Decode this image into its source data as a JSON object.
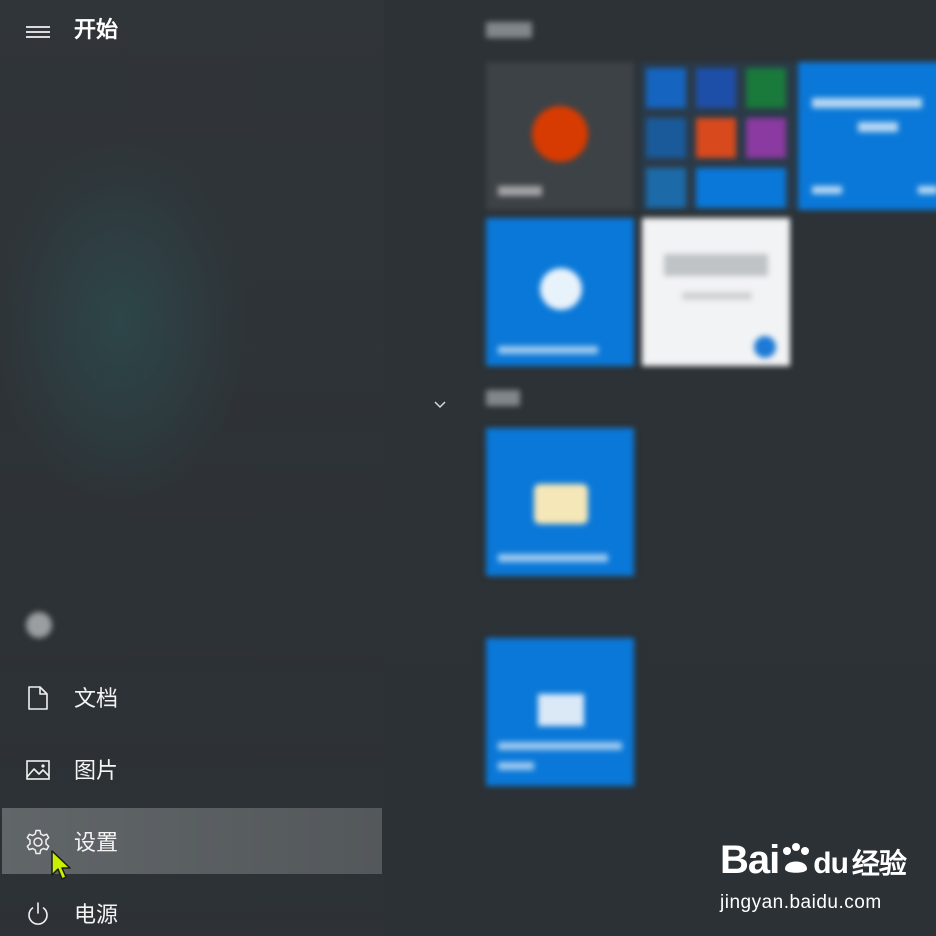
{
  "start_menu": {
    "title": "开始",
    "user_name": "",
    "items": [
      {
        "label": "文档",
        "icon": "document-icon"
      },
      {
        "label": "图片",
        "icon": "pictures-icon"
      },
      {
        "label": "设置",
        "icon": "gear-icon",
        "selected": true
      },
      {
        "label": "电源",
        "icon": "power-icon"
      }
    ]
  },
  "tiles": {
    "accent": "#0a78d8"
  },
  "watermark": {
    "logo": "Bai du 经验",
    "logo_brand": "Bai",
    "logo_du": "du",
    "logo_cn": "经验",
    "url": "jingyan.baidu.com"
  }
}
